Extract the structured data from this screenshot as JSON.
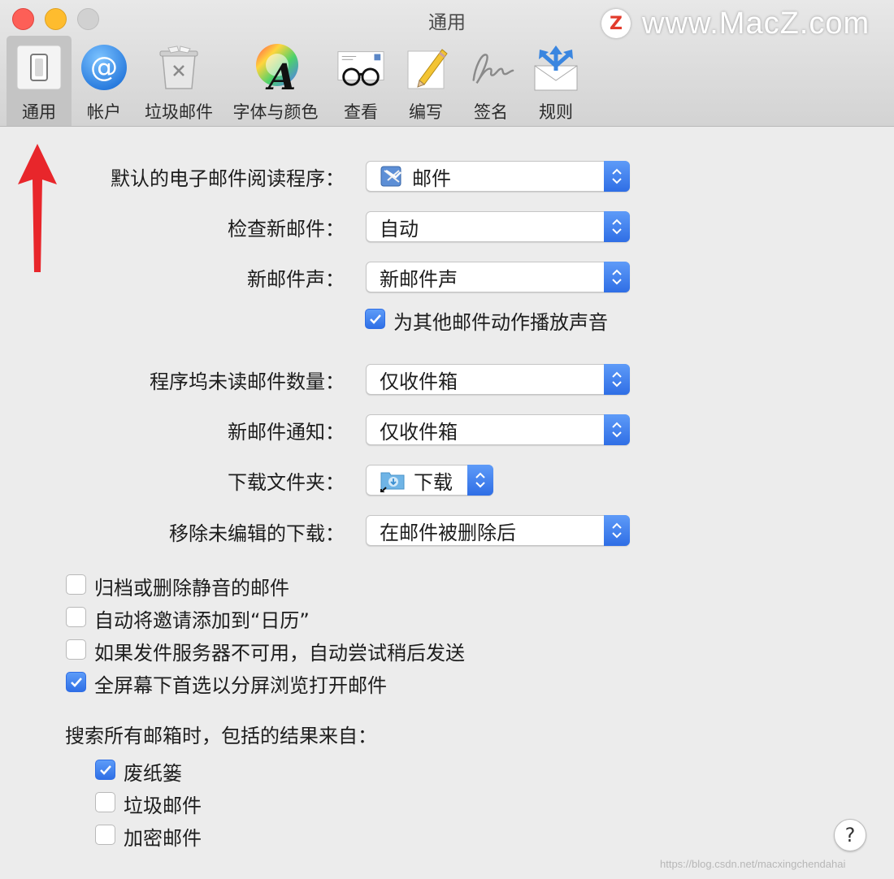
{
  "window": {
    "title": "通用"
  },
  "watermark": {
    "logo_letter": "Z",
    "text": "www.MacZ.com"
  },
  "toolbar": {
    "tabs": [
      {
        "label": "通用",
        "icon": "general-switch-icon",
        "active": true
      },
      {
        "label": "帐户",
        "icon": "at-sign-icon"
      },
      {
        "label": "垃圾邮件",
        "icon": "trash-bin-icon"
      },
      {
        "label": "字体与颜色",
        "icon": "font-color-wheel-icon"
      },
      {
        "label": "查看",
        "icon": "glasses-envelope-icon"
      },
      {
        "label": "编写",
        "icon": "pencil-paper-icon"
      },
      {
        "label": "签名",
        "icon": "signature-icon"
      },
      {
        "label": "规则",
        "icon": "rules-envelope-icon"
      }
    ]
  },
  "settings": {
    "default_reader": {
      "label": "默认的电子邮件阅读程序：",
      "value": "邮件",
      "icon": "mail-app-icon"
    },
    "check_new_mail": {
      "label": "检查新邮件：",
      "value": "自动"
    },
    "new_mail_sound": {
      "label": "新邮件声：",
      "value": "新邮件声"
    },
    "play_sounds": {
      "label": "为其他邮件动作播放声音",
      "checked": true
    },
    "dock_unread": {
      "label": "程序坞未读邮件数量：",
      "value": "仅收件箱"
    },
    "new_mail_notify": {
      "label": "新邮件通知：",
      "value": "仅收件箱"
    },
    "downloads_folder": {
      "label": "下载文件夹：",
      "value": "下载",
      "icon": "downloads-folder-icon"
    },
    "remove_downloads": {
      "label": "移除未编辑的下载：",
      "value": "在邮件被删除后"
    }
  },
  "options": [
    {
      "label": "归档或删除静音的邮件",
      "checked": false
    },
    {
      "label": "自动将邀请添加到“日历”",
      "checked": false
    },
    {
      "label": "如果发件服务器不可用，自动尝试稍后发送",
      "checked": false
    },
    {
      "label": "全屏幕下首选以分屏浏览打开邮件",
      "checked": true
    }
  ],
  "search": {
    "heading": "搜索所有邮箱时，包括的结果来自：",
    "items": [
      {
        "label": "废纸篓",
        "checked": true
      },
      {
        "label": "垃圾邮件",
        "checked": false
      },
      {
        "label": "加密邮件",
        "checked": false
      }
    ]
  },
  "help": {
    "label": "?"
  },
  "credit": "https://blog.csdn.net/macxingchendahai",
  "colors": {
    "accent": "#2f6ee5",
    "arrow": "#e8262b",
    "background": "#ececec"
  }
}
